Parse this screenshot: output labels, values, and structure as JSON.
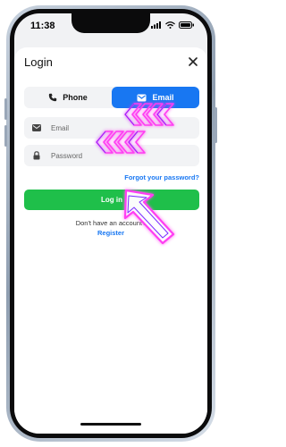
{
  "status_bar": {
    "time": "11:38",
    "icons": [
      "signal-icon",
      "wifi-icon",
      "battery-icon"
    ]
  },
  "login": {
    "title": "Login",
    "close_icon": "close-icon",
    "tabs": [
      {
        "label": "Phone",
        "icon": "phone-icon",
        "selected": false
      },
      {
        "label": "Email",
        "icon": "mail-icon",
        "selected": true
      }
    ],
    "email": {
      "placeholder": "Email",
      "value": "",
      "icon": "mail-icon"
    },
    "password": {
      "placeholder": "Password",
      "value": "",
      "icon": "lock-icon"
    },
    "forgot_label": "Forgot your password?",
    "login_label": "Log in",
    "no_account_text": "Don't have an account?",
    "register_label": "Register"
  },
  "colors": {
    "accent_blue": "#1877f2",
    "login_green": "#1fbf4a",
    "neon_pink": "#ff3df2",
    "neon_purple": "#7a2cff"
  }
}
